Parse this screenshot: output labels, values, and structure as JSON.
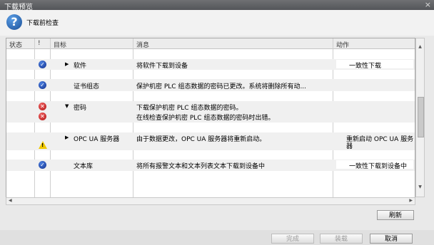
{
  "window": {
    "title": "下载预览",
    "close_glyph": "×"
  },
  "header": {
    "title": "下载前检查"
  },
  "columns": {
    "status": "状态",
    "excl": "!",
    "target": "目标",
    "message": "消息",
    "action": "动作"
  },
  "rows": [
    {
      "icon": "ok",
      "target": "软件",
      "message": "将软件下载到设备",
      "action": "一致性下载"
    },
    {
      "icon": "ok",
      "target": "证书组态",
      "message": "保护机密 PLC 组态数据的密码已更改。系统将删除所有动...",
      "action": ""
    },
    {
      "icon": "error",
      "target": "密码",
      "message": "下载保护机密 PLC 组态数据的密码。",
      "action": ""
    },
    {
      "icon": "error",
      "target": "",
      "message": "在线检查保护机密 PLC 组态数据的密码时出错。",
      "action": ""
    },
    {
      "icon": "warning",
      "target": "OPC UA 服务器",
      "message": "由于数据更改，OPC UA 服务器将重新启动。",
      "action": "重新启动 OPC UA 服务",
      "action2": "器"
    },
    {
      "icon": "ok",
      "target": "文本库",
      "message": "将所有报警文本和文本列表文本下载到设备中",
      "action": "一致性下载到设备中"
    }
  ],
  "buttons": {
    "refresh": "刷新",
    "finish": "完成",
    "load": "装载",
    "cancel": "取消"
  }
}
